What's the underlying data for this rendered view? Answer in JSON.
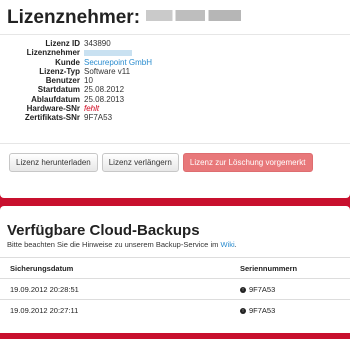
{
  "license": {
    "title": "Lizenznehmer:",
    "fields": [
      {
        "label": "Lizenz ID",
        "value": "343890"
      },
      {
        "label": "Lizenznehmer",
        "value": ""
      },
      {
        "label": "Kunde",
        "value": "Securepoint GmbH"
      },
      {
        "label": "Lizenz-Typ",
        "value": "Software v11"
      },
      {
        "label": "Benutzer",
        "value": "10"
      },
      {
        "label": "Startdatum",
        "value": "25.08.2012"
      },
      {
        "label": "Ablaufdatum",
        "value": "25.08.2013"
      },
      {
        "label": "Hardware-SNr",
        "value": "fehlt"
      },
      {
        "label": "Zertifikats-SNr",
        "value": "9F7A53"
      }
    ],
    "buttons": {
      "download": "Lizenz herunterladen",
      "extend": "Lizenz verlängern",
      "delete": "Lizenz zur Löschung vorgemerkt"
    }
  },
  "backups": {
    "title": "Verfügbare Cloud-Backups",
    "hint_text": "Bitte beachten Sie die Hinweise zu unserem Backup-Service im",
    "hint_link": "Wiki",
    "hint_end": ".",
    "columns": [
      "Sicherungsdatum",
      "Seriennummern"
    ],
    "rows": [
      {
        "date": "19.09.2012 20:28:51",
        "serial": "9F7A53"
      },
      {
        "date": "19.09.2012 20:27:11",
        "serial": "9F7A53"
      }
    ]
  }
}
